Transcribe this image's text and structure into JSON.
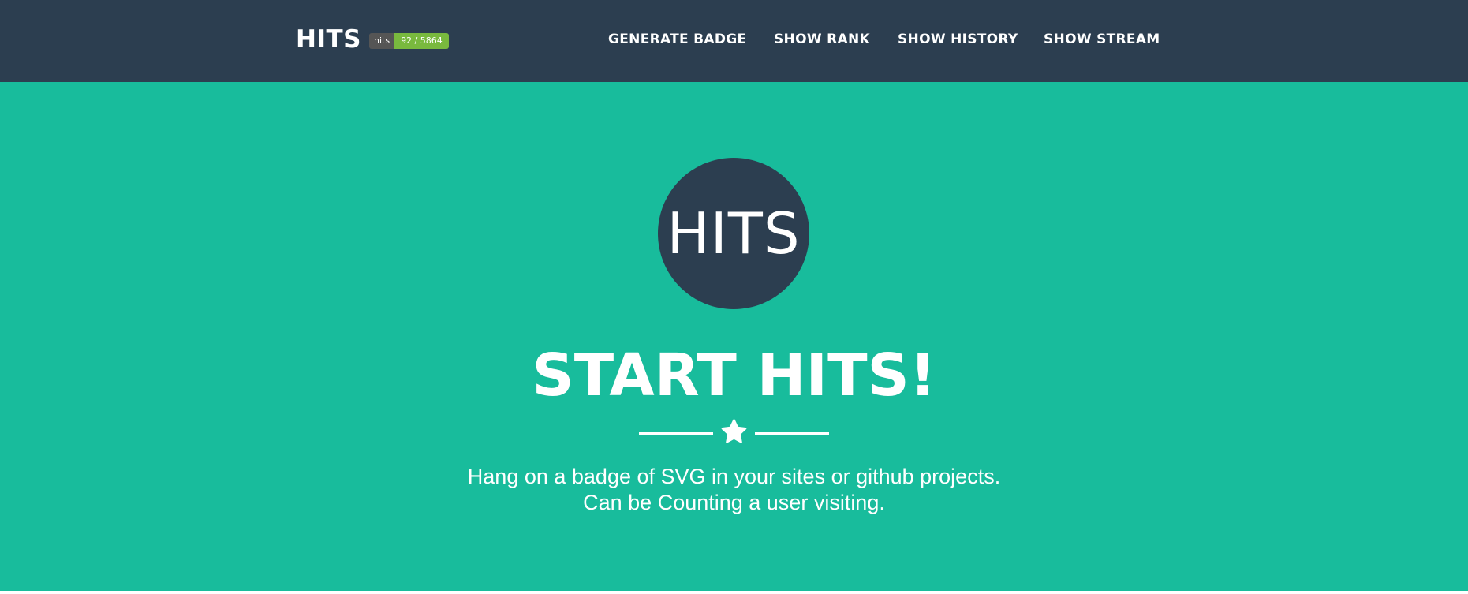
{
  "navbar": {
    "brand": "HITS",
    "badge": {
      "label": "hits",
      "value": "92 / 5864",
      "label_color": "#555555",
      "value_color": "#79b93e"
    },
    "links": [
      {
        "label": "GENERATE BADGE"
      },
      {
        "label": "SHOW RANK"
      },
      {
        "label": "SHOW HISTORY"
      },
      {
        "label": "SHOW STREAM"
      }
    ],
    "background": "#2c3e50"
  },
  "hero": {
    "logo_text": "HITS",
    "title": "START HITS!",
    "divider_icon": "star-icon",
    "subtitle_line1": "Hang on a badge of SVG in your sites or github projects.",
    "subtitle_line2": "Can be Counting a user visiting.",
    "background": "#18bc9c"
  }
}
